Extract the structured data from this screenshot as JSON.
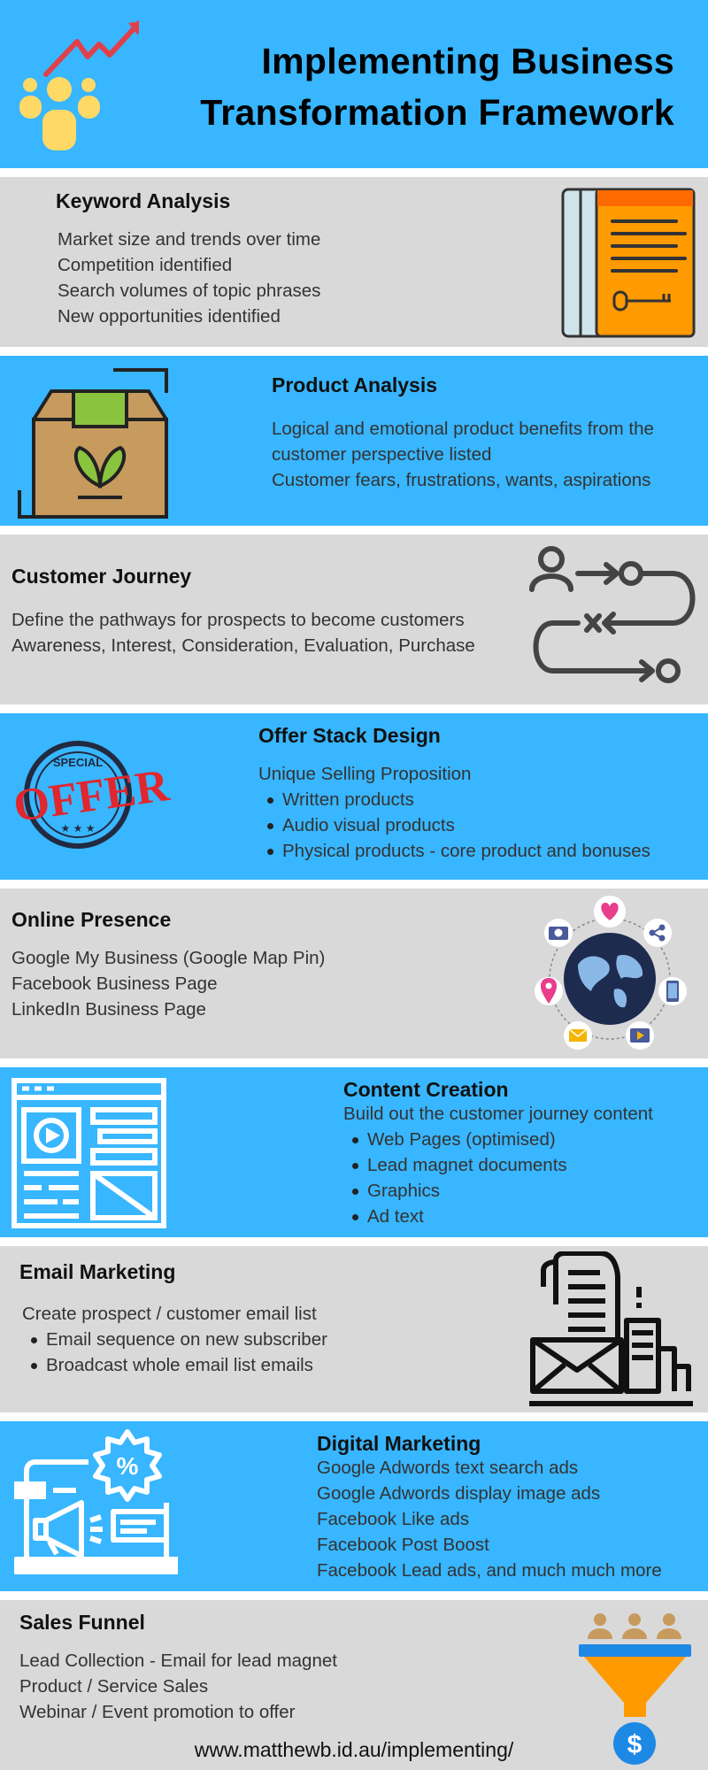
{
  "header": {
    "title_line1": "Implementing Business",
    "title_line2": "Transformation Framework",
    "colors": {
      "background": "#38b6ff",
      "people": "#ffd966",
      "arrow": "#e0404a"
    }
  },
  "sections": [
    {
      "id": "keyword-analysis",
      "title": "Keyword Analysis",
      "background": "grey",
      "items": [
        {
          "text": "Market size and trends over time",
          "bullet": false
        },
        {
          "text": "Competition identified",
          "bullet": false
        },
        {
          "text": "Search volumes of topic phrases",
          "bullet": false
        },
        {
          "text": "New opportunities identified",
          "bullet": false
        }
      ],
      "icon": "keyword-book-icon"
    },
    {
      "id": "product-analysis",
      "title": "Product Analysis",
      "background": "blue",
      "items": [
        {
          "text": "Logical and emotional product benefits from the",
          "bullet": false
        },
        {
          "text": "customer perspective listed",
          "bullet": false
        },
        {
          "text": "Customer fears, frustrations, wants, aspirations",
          "bullet": false
        }
      ],
      "icon": "product-box-icon"
    },
    {
      "id": "customer-journey",
      "title": "Customer Journey",
      "background": "grey",
      "items": [
        {
          "text": "Define the pathways for prospects to become customers",
          "bullet": false
        },
        {
          "text": "Awareness, Interest, Consideration, Evaluation, Purchase",
          "bullet": false
        }
      ],
      "icon": "journey-path-icon"
    },
    {
      "id": "offer-stack-design",
      "title": "Offer Stack Design",
      "background": "blue",
      "items": [
        {
          "text": "Unique Selling Proposition",
          "bullet": false
        },
        {
          "text": "Written products",
          "bullet": true
        },
        {
          "text": "Audio visual products",
          "bullet": true
        },
        {
          "text": "Physical products - core product and bonuses",
          "bullet": true
        }
      ],
      "icon": "special-offer-stamp-icon",
      "stamp": {
        "top": "SPECIAL",
        "main": "OFFER",
        "stars": "★ ★ ★"
      }
    },
    {
      "id": "online-presence",
      "title": "Online Presence",
      "background": "grey",
      "items": [
        {
          "text": "Google My Business (Google Map Pin)",
          "bullet": false
        },
        {
          "text": "Facebook Business Page",
          "bullet": false
        },
        {
          "text": "LinkedIn Business Page",
          "bullet": false
        }
      ],
      "icon": "globe-network-icon"
    },
    {
      "id": "content-creation",
      "title": "Content Creation",
      "background": "blue",
      "items": [
        {
          "text": "Build out the customer journey content",
          "bullet": false
        },
        {
          "text": "Web Pages (optimised)",
          "bullet": true
        },
        {
          "text": "Lead magnet documents",
          "bullet": true
        },
        {
          "text": "Graphics",
          "bullet": true
        },
        {
          "text": "Ad text",
          "bullet": true
        }
      ],
      "icon": "web-layout-icon"
    },
    {
      "id": "email-marketing",
      "title": "Email Marketing",
      "background": "grey",
      "items": [
        {
          "text": "Create prospect / customer email list",
          "bullet": false
        },
        {
          "text": "Email sequence on new subscriber",
          "bullet": true
        },
        {
          "text": "Broadcast whole email list emails",
          "bullet": true
        }
      ],
      "icon": "email-document-icon"
    },
    {
      "id": "digital-marketing",
      "title": "Digital Marketing",
      "background": "blue",
      "items": [
        {
          "text": "Google Adwords text search ads",
          "bullet": false
        },
        {
          "text": "Google Adwords display image ads",
          "bullet": false
        },
        {
          "text": "Facebook Like ads",
          "bullet": false
        },
        {
          "text": "Facebook Post Boost",
          "bullet": false
        },
        {
          "text": "Facebook Lead ads, and much much more",
          "bullet": false
        }
      ],
      "icon": "megaphone-discount-icon",
      "badge_symbol": "%"
    },
    {
      "id": "sales-funnel",
      "title": "Sales Funnel",
      "background": "grey",
      "items": [
        {
          "text": "Lead Collection - Email for lead magnet",
          "bullet": false
        },
        {
          "text": "Product / Service Sales",
          "bullet": false
        },
        {
          "text": "Webinar / Event promotion to offer",
          "bullet": false
        }
      ],
      "icon": "sales-funnel-icon",
      "currency_symbol": "$"
    }
  ],
  "footer": {
    "url": "www.matthewb.id.au/implementing/"
  }
}
